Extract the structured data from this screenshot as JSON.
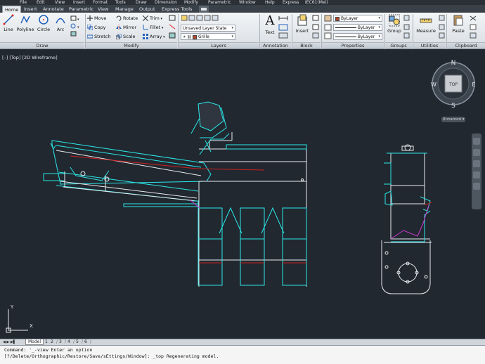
{
  "menu": [
    "File",
    "Edit",
    "View",
    "Insert",
    "Format",
    "Tools",
    "Draw",
    "Dimension",
    "Modify",
    "Parametric",
    "Window",
    "Help",
    "Express",
    "IEC61(Mei)"
  ],
  "ribbon_tabs": [
    "Home",
    "Insert",
    "Annotate",
    "Parametric",
    "View",
    "Manage",
    "Output",
    "Express Tools"
  ],
  "active_tab": "Home",
  "draw": {
    "line": "Line",
    "polyline": "Polyline",
    "circle": "Circle",
    "arc": "Arc",
    "title": "Draw"
  },
  "modify": {
    "move": "Move",
    "copy": "Copy",
    "stretch": "Stretch",
    "rotate": "Rotate",
    "mirror": "Mirror",
    "scale": "Scale",
    "trim": "Trim",
    "fillet": "Fillet",
    "array": "Array",
    "title": "Modify"
  },
  "layers": {
    "state": "Unsaved Layer State",
    "current": "Grille",
    "title": "Layers"
  },
  "annotation": {
    "text": "Text",
    "title": "Annotation"
  },
  "block": {
    "insert": "Insert",
    "title": "Block"
  },
  "properties": {
    "color": "ByLayer",
    "linetype": "ByLayer",
    "lineweight": "ByLayer",
    "title": "Properties"
  },
  "groups": {
    "group": "Group",
    "title": "Groups"
  },
  "utilities": {
    "measure": "Measure",
    "title": "Utilities"
  },
  "clipboard": {
    "paste": "Paste",
    "title": "Clipboard"
  },
  "viewport_label": "[–] [Top] [2D Wireframe]",
  "viewcube": {
    "n": "N",
    "s": "S",
    "e": "E",
    "w": "W",
    "face": "TOP",
    "ucs": "Unnamed"
  },
  "ucs": {
    "x": "X",
    "y": "Y"
  },
  "layout_tabs": [
    "Model",
    "1",
    "2",
    "3",
    "4",
    "5",
    "6"
  ],
  "command": {
    "line1": "Command: '_-view Enter an option",
    "line2": "[?/Delete/Orthographic/Restore/Save/sEttings/Window]: _top Regenerating model."
  },
  "colors": {
    "cyan": "#2be8e8",
    "white": "#e8ecef",
    "red": "#d02020",
    "magenta": "#d23ad2",
    "background": "#212830"
  }
}
